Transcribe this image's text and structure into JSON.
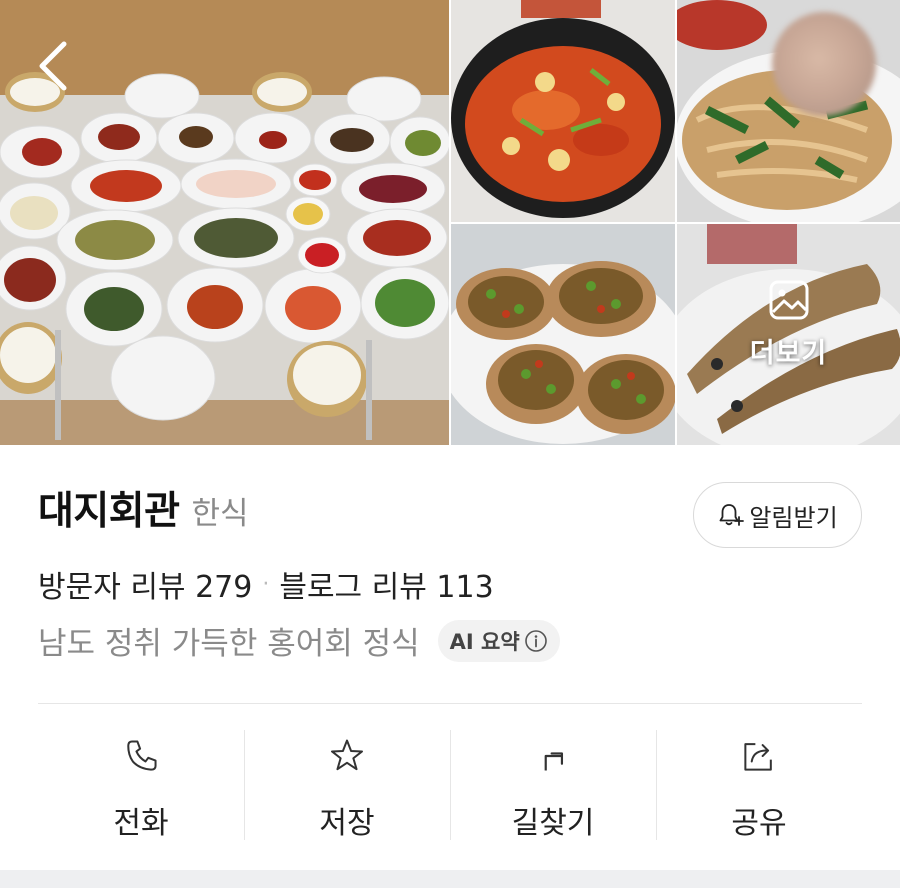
{
  "gallery": {
    "back_icon": "chevron-left-icon",
    "more_icon": "image-icon",
    "more_label": "더보기"
  },
  "place": {
    "name": "대지회관",
    "category": "한식"
  },
  "notify_button": {
    "icon": "bell-plus-icon",
    "label": "알림받기"
  },
  "reviews": {
    "visitor_label": "방문자 리뷰 279",
    "separator": "·",
    "blog_label": "블로그 리뷰 113"
  },
  "summary": {
    "text": "남도 정취 가득한 홍어회 정식",
    "ai_chip_label": "AI 요약",
    "ai_chip_icon": "info-icon"
  },
  "actions": [
    {
      "icon": "phone-icon",
      "label": "전화"
    },
    {
      "icon": "star-icon",
      "label": "저장"
    },
    {
      "icon": "directions-icon",
      "label": "길찾기"
    },
    {
      "icon": "share-icon",
      "label": "공유"
    }
  ],
  "colors": {
    "text_primary": "#222222",
    "text_secondary": "#8a8a8a",
    "divider": "#e6e6e6",
    "chip_bg": "#f2f2f2"
  }
}
